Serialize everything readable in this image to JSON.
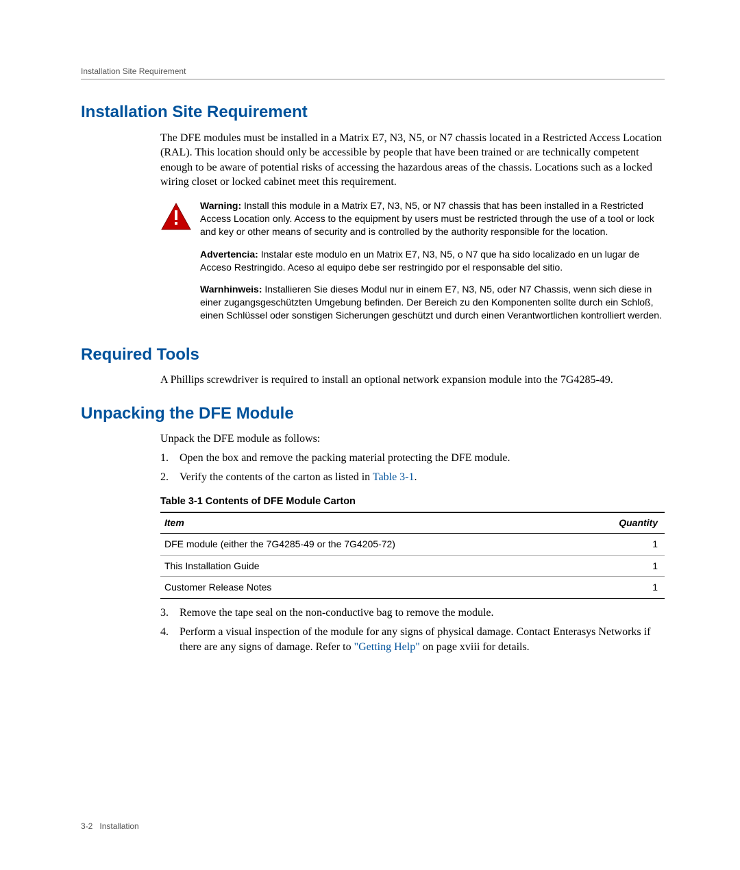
{
  "runningHeader": "Installation Site Requirement",
  "footer": {
    "pagenum": "3-2",
    "chapter": "Installation"
  },
  "sec1": {
    "title": "Installation Site Requirement",
    "body": "The DFE modules must be installed in a Matrix E7, N3, N5, or N7 chassis located in a Restricted Access Location (RAL). This location should only be accessible by people that have been trained or are technically competent enough to be aware of potential risks of accessing the hazardous areas of the chassis. Locations such as a locked wiring closet or locked cabinet meet this requirement.",
    "warnLabel": "Warning:",
    "warnEn": " Install this module in a Matrix E7, N3, N5, or N7 chassis that has been installed in a Restricted Access Location only. Access to the equipment by users must be restricted through the use of a tool or lock and key or other means of security and is controlled by the authority responsible for the location.",
    "advLabel": "Advertencia:",
    "warnEs": " Instalar este modulo en un Matrix E7, N3, N5, o N7 que ha sido localizado en un lugar de Acceso Restringido. Aceso al equipo debe ser restringido por el responsable del sitio.",
    "hinLabel": "Warnhinweis:",
    "warnDe": " Installieren Sie dieses Modul nur in einem E7, N3, N5, oder N7 Chassis, wenn sich diese in einer zugangsgeschützten Umgebung befinden. Der Bereich zu den Komponenten sollte durch ein Schloß, einen Schlüssel oder sonstigen Sicherungen geschützt und durch einen Verantwortlichen kontrolliert werden."
  },
  "sec2": {
    "title": "Required Tools",
    "body": "A Phillips screwdriver is required to install an optional network expansion module into the 7G4285-49."
  },
  "sec3": {
    "title": "Unpacking the DFE Module",
    "intro": "Unpack the DFE module as follows:",
    "step1": "Open the box and remove the packing material protecting the DFE module.",
    "step2a": "Verify the contents of the carton as listed in ",
    "step2link": "Table 3-1",
    "step2b": ".",
    "tableCaption": "Table 3-1   Contents of DFE Module Carton",
    "thItem": "Item",
    "thQty": "Quantity",
    "rows": [
      {
        "item": "DFE module (either the 7G4285-49 or the 7G4205-72)",
        "qty": "1"
      },
      {
        "item": "This Installation Guide",
        "qty": "1"
      },
      {
        "item": "Customer Release Notes",
        "qty": "1"
      }
    ],
    "step3": "Remove the tape seal on the non-conductive bag to remove the module.",
    "step4a": "Perform a visual inspection of the module for any signs of physical damage. Contact Enterasys Networks if there are any signs of damage. Refer to ",
    "step4link": "\"Getting Help\"",
    "step4b": "  on page xviii for details."
  }
}
